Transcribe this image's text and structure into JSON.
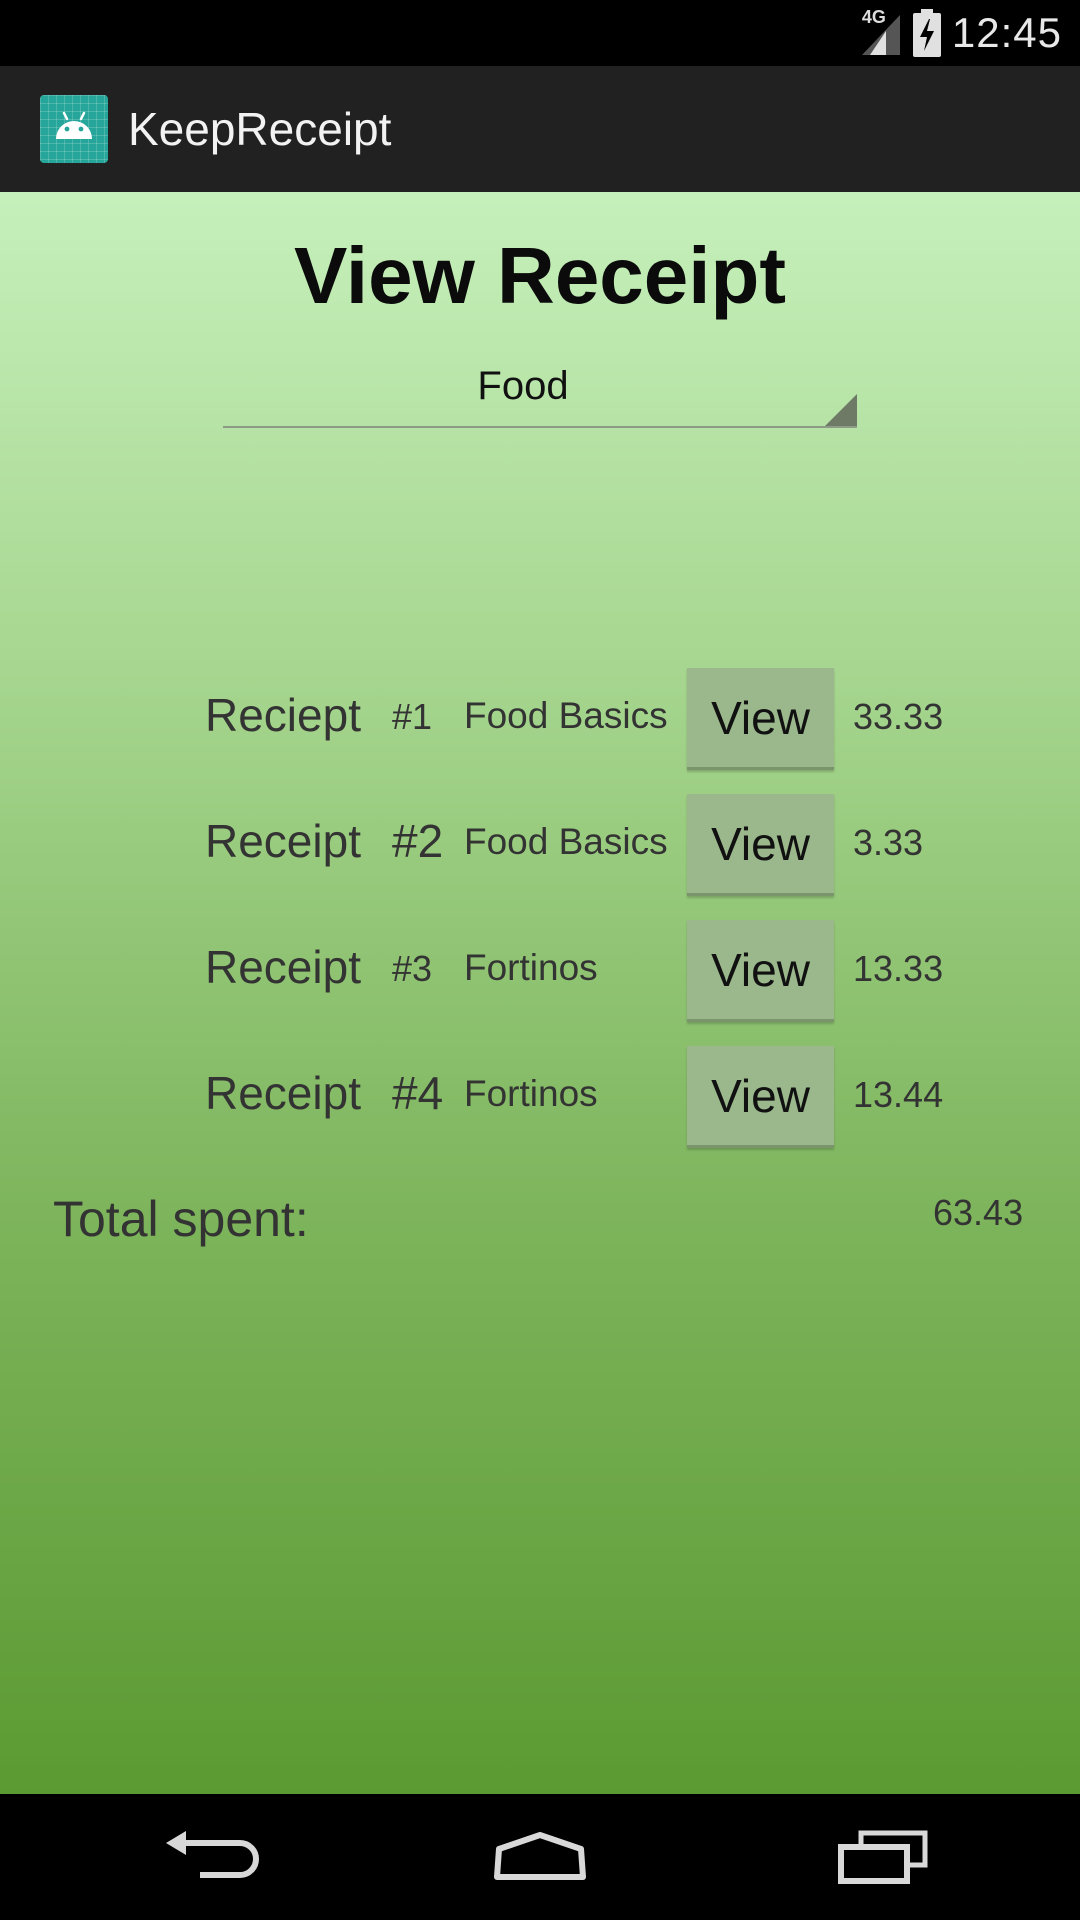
{
  "status_bar": {
    "network": "4G",
    "time": "12:45"
  },
  "action_bar": {
    "app_title": "KeepReceipt"
  },
  "page": {
    "title": "View Receipt",
    "category_spinner": {
      "selected": "Food"
    }
  },
  "receipts": [
    {
      "label": "Reciept",
      "number": "#1",
      "store": "Food Basics",
      "button": "View",
      "amount": "33.33"
    },
    {
      "label": "Receipt",
      "number": "#2",
      "store": "Food Basics",
      "button": "View",
      "amount": "3.33"
    },
    {
      "label": "Receipt",
      "number": "#3",
      "store": "Fortinos",
      "button": "View",
      "amount": "13.33"
    },
    {
      "label": "Receipt",
      "number": "#4",
      "store": "Fortinos",
      "button": "View",
      "amount": "13.44"
    }
  ],
  "total": {
    "label": "Total spent:",
    "value": "63.43"
  },
  "nav": {
    "icons": [
      "back-icon",
      "home-icon",
      "recents-icon"
    ]
  },
  "colors": {
    "background_top": "#c6f0bb",
    "background_bottom": "#5b9a32",
    "button": "#9ab88c",
    "action_bar": "#212121",
    "app_icon": "#26a69a"
  }
}
